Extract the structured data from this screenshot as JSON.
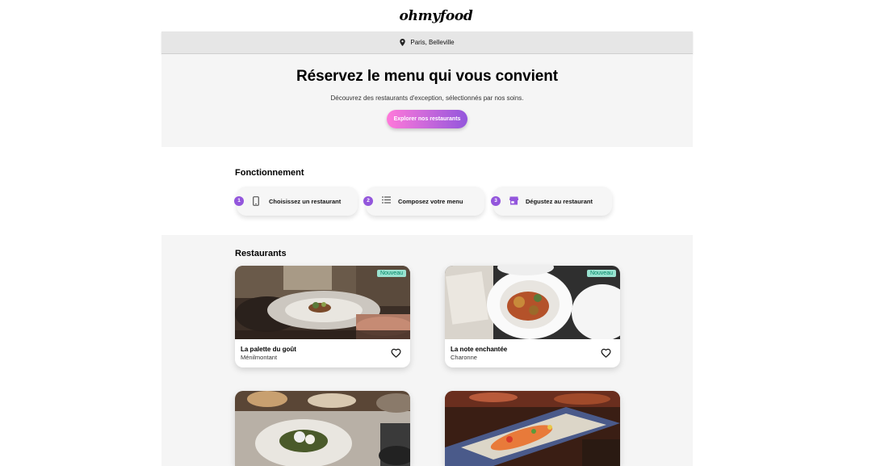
{
  "brand": {
    "logo": "ohmyfood"
  },
  "location": {
    "label": "Paris, Belleville",
    "icon": "location-pin-icon"
  },
  "hero": {
    "title": "Réservez le menu qui vous convient",
    "subtitle": "Découvrez des restaurants d'exception, sélectionnés par nos soins.",
    "cta_label": "Explorer nos restaurants"
  },
  "how_it_works": {
    "title": "Fonctionnement",
    "steps": [
      {
        "number": "1",
        "label": "Choisissez un restaurant",
        "icon": "smartphone-icon"
      },
      {
        "number": "2",
        "label": "Composez votre menu",
        "icon": "list-icon"
      },
      {
        "number": "3",
        "label": "Dégustez au restaurant",
        "icon": "storefront-icon"
      }
    ]
  },
  "restaurants": {
    "title": "Restaurants",
    "items": [
      {
        "name": "La palette du goût",
        "area": "Ménilmontant",
        "badge": "Nouveau"
      },
      {
        "name": "La note enchantée",
        "area": "Charonne",
        "badge": "Nouveau"
      },
      {
        "name": "",
        "area": "",
        "badge": ""
      },
      {
        "name": "",
        "area": "",
        "badge": ""
      }
    ]
  },
  "colors": {
    "primary": "#9356dc",
    "secondary": "#ff79da",
    "tertiary": "#99e2d0",
    "badge_text": "#008766"
  }
}
